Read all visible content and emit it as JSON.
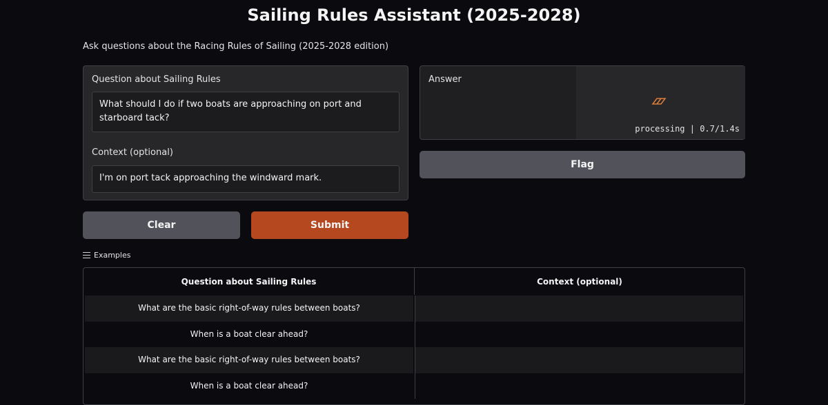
{
  "header": {
    "title": "Sailing Rules Assistant (2025-2028)",
    "subtitle": "Ask questions about the Racing Rules of Sailing (2025-2028 edition)"
  },
  "inputs": {
    "question_label": "Question about Sailing Rules",
    "question_value": "What should I do if two boats are approaching on port and starboard tack?",
    "context_label": "Context (optional)",
    "context_value": "I'm on port tack approaching the windward mark."
  },
  "output": {
    "answer_label": "Answer",
    "status": "processing | 0.7/1.4s",
    "progress_fraction": 0.5,
    "spinner_icon": "spinner-icon",
    "accent_color": "#d97c3a"
  },
  "buttons": {
    "flag": "Flag",
    "clear": "Clear",
    "submit": "Submit",
    "submit_color": "#b5481f"
  },
  "examples": {
    "header": "Examples",
    "icon": "list-icon",
    "columns": [
      "Question about Sailing Rules",
      "Context (optional)"
    ],
    "rows": [
      [
        "What are the basic right-of-way rules between boats?",
        ""
      ],
      [
        "When is a boat clear ahead?",
        ""
      ],
      [
        "What are the basic right-of-way rules between boats?",
        ""
      ],
      [
        "When is a boat clear ahead?",
        ""
      ]
    ]
  }
}
